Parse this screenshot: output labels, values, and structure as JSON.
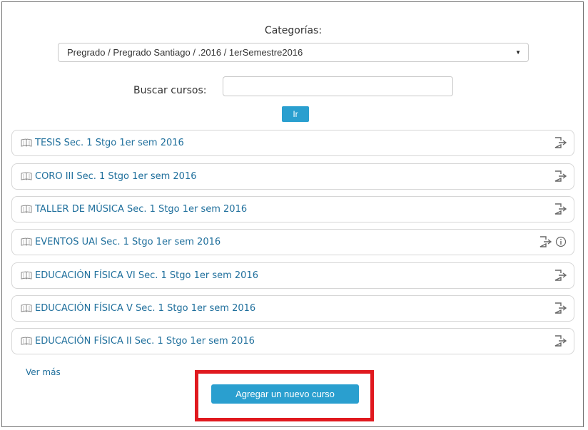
{
  "categories": {
    "label": "Categorías",
    "selected": "Pregrado / Pregrado Santiago / .2016 / 1erSemestre2016"
  },
  "search": {
    "label": "Buscar cursos:",
    "value": "",
    "go_label": "Ir"
  },
  "courses": [
    {
      "title": "TESIS Sec. 1 Stgo 1er sem 2016",
      "icons": [
        "enrol-icon"
      ]
    },
    {
      "title": "CORO III Sec. 1 Stgo 1er sem 2016",
      "icons": [
        "enrol-icon"
      ]
    },
    {
      "title": "TALLER DE MÚSICA Sec. 1 Stgo 1er sem 2016",
      "icons": [
        "enrol-icon"
      ]
    },
    {
      "title": "EVENTOS UAI Sec. 1 Stgo 1er sem 2016",
      "icons": [
        "enrol-icon",
        "info-icon"
      ]
    },
    {
      "title": "EDUCACIÓN FÍSICA VI Sec. 1 Stgo 1er sem 2016",
      "icons": [
        "enrol-icon"
      ]
    },
    {
      "title": "EDUCACIÓN FÍSICA V Sec. 1 Stgo 1er sem 2016",
      "icons": [
        "enrol-icon"
      ]
    },
    {
      "title": "EDUCACIÓN FÍSICA II Sec. 1 Stgo 1er sem 2016",
      "icons": [
        "enrol-icon"
      ]
    }
  ],
  "more_link": "Ver más",
  "add_course_label": "Agregar un nuevo curso",
  "colors": {
    "accent": "#2a9fcf",
    "link": "#1f6f9c",
    "highlight": "#e0191f"
  }
}
